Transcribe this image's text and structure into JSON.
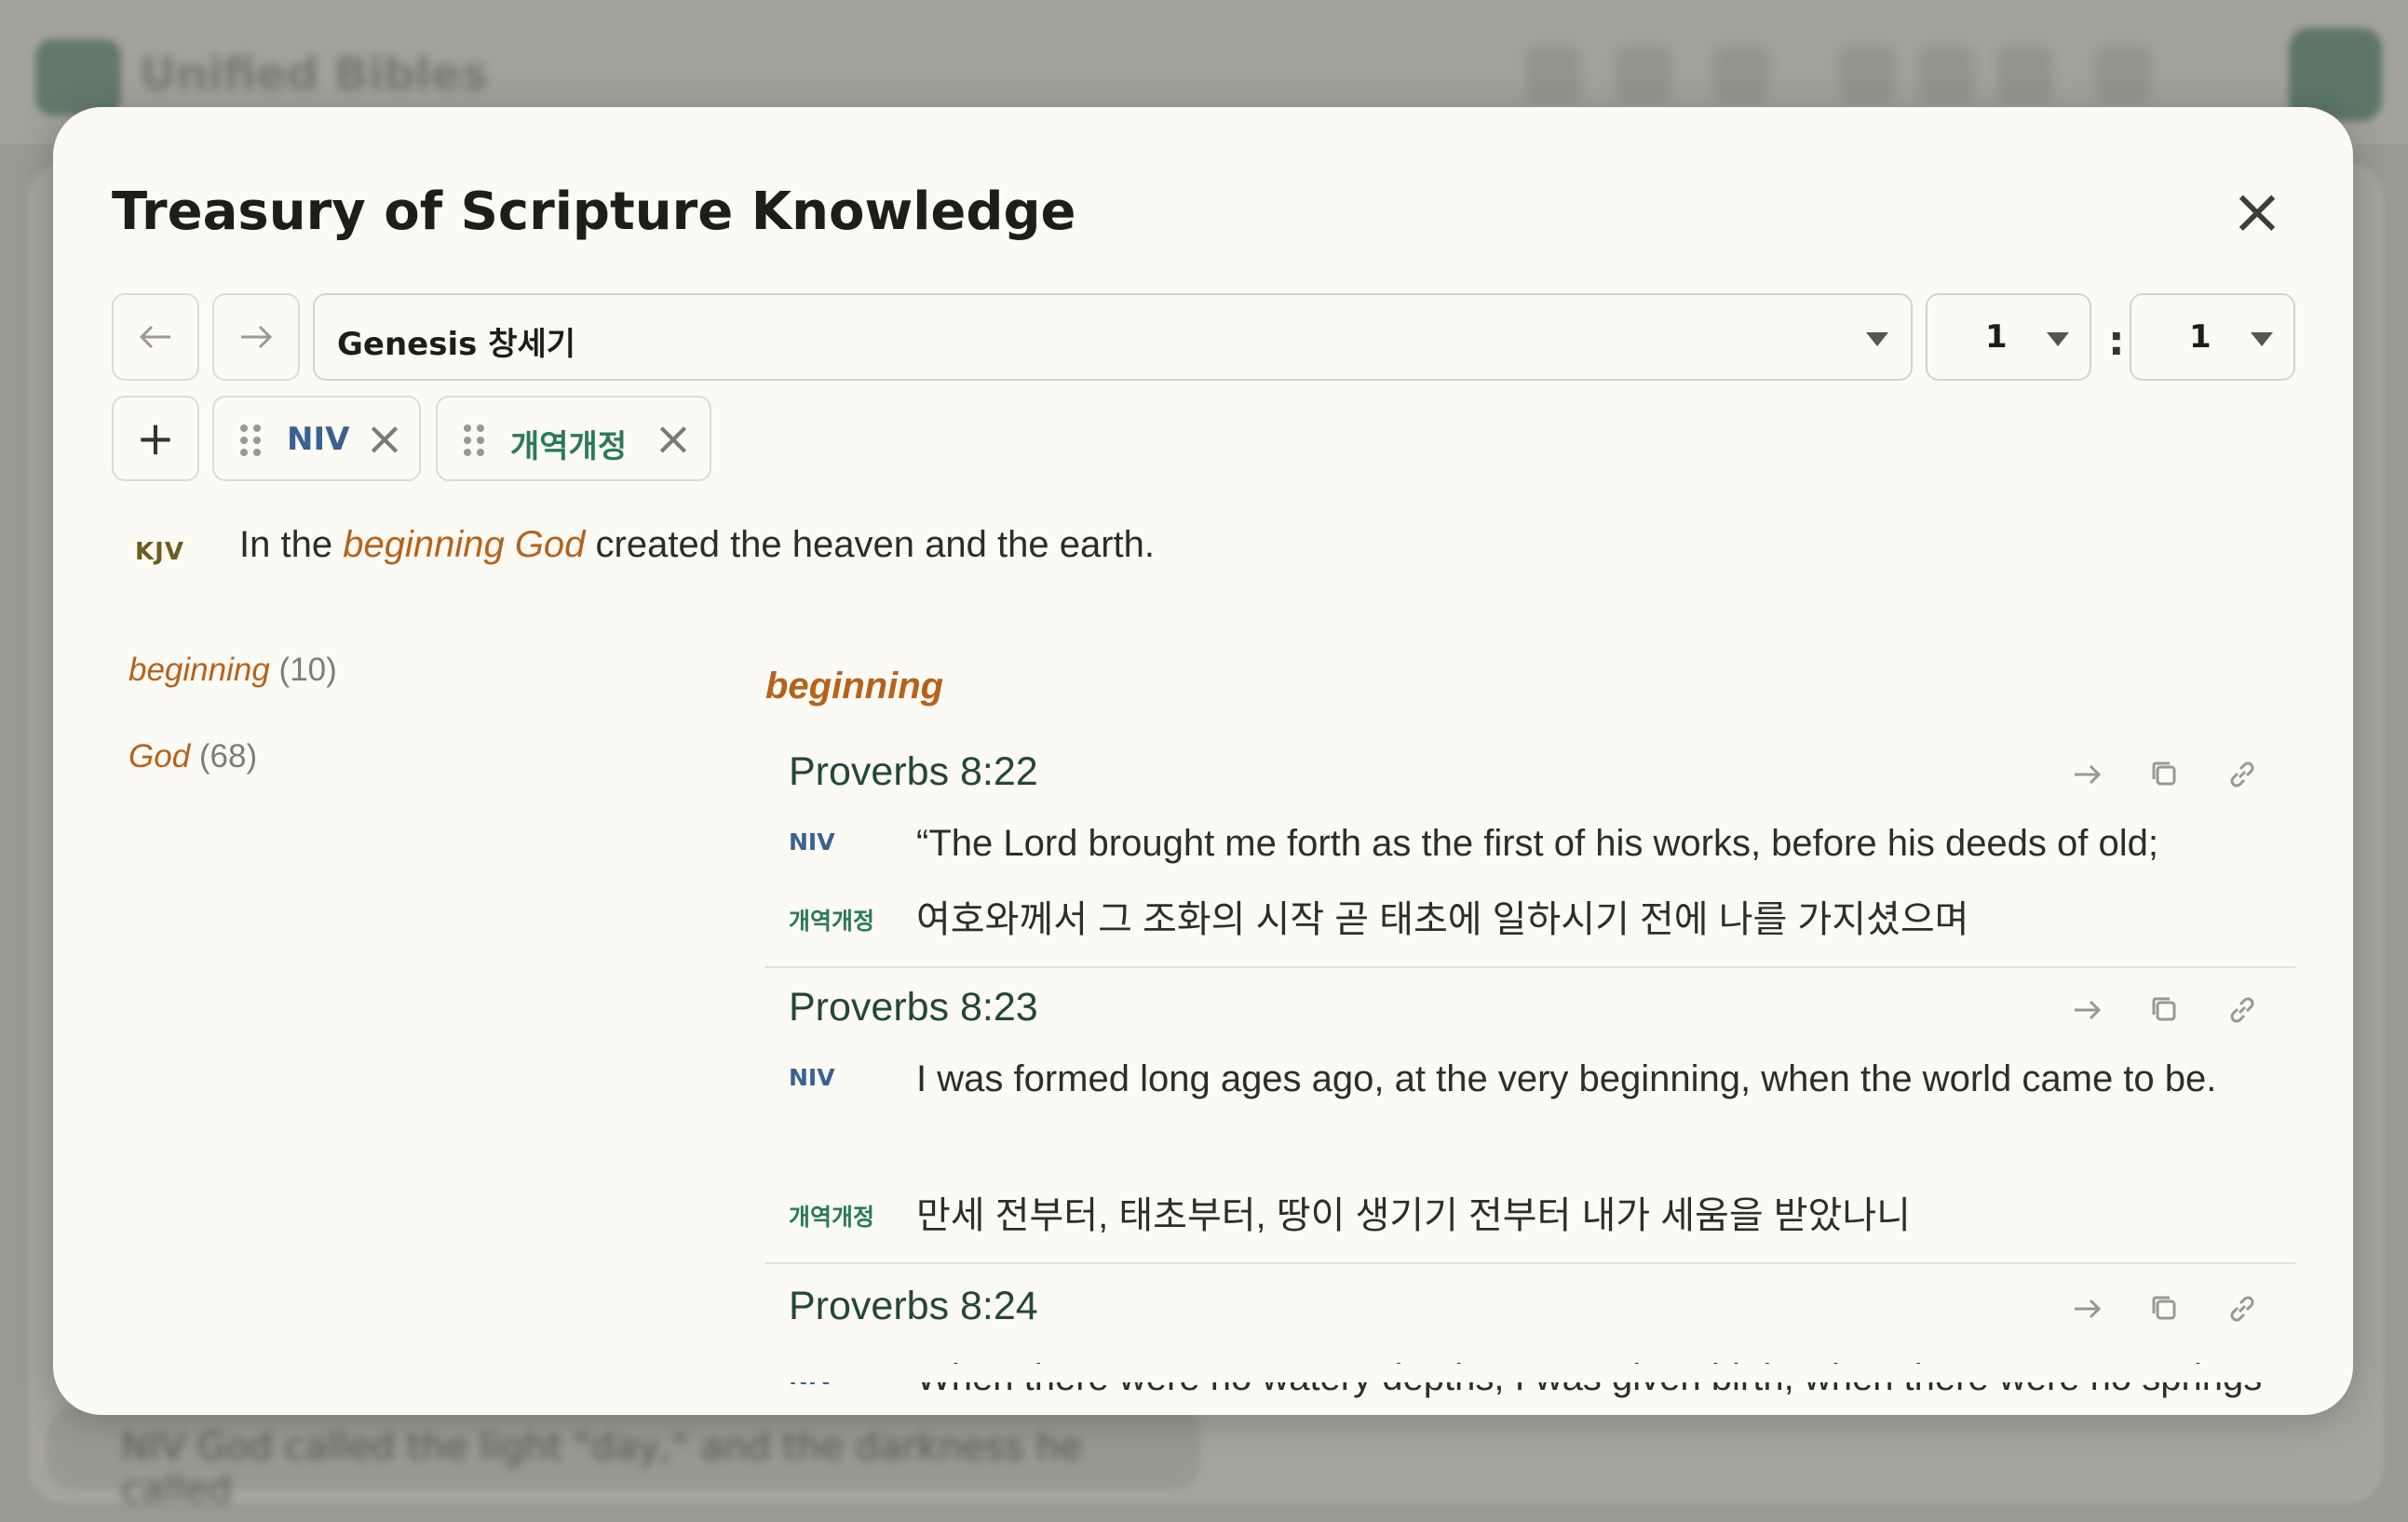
{
  "background": {
    "app_title": "Unified Bibles",
    "bottom_verse": "NIV God called the light \"day,\" and the darkness he called"
  },
  "modal": {
    "title": "Treasury of Scripture Knowledge",
    "close_icon": "close-icon"
  },
  "nav": {
    "back_icon": "arrow-left-icon",
    "forward_icon": "arrow-right-icon",
    "book": "Genesis 창세기",
    "chapter": "1",
    "separator": ":",
    "verse": "1"
  },
  "versions": {
    "add_label": "+",
    "chips": [
      {
        "label": "NIV",
        "color": "#3a6191"
      },
      {
        "label": "개역개정",
        "color": "#2b7a58"
      }
    ]
  },
  "main_verse": {
    "version": "KJV",
    "text_before": "In the ",
    "highlight": "beginning God",
    "text_after": " created the heaven and the earth."
  },
  "keywords": [
    {
      "word": "beginning",
      "count": "(10)"
    },
    {
      "word": "God",
      "count": "(68)"
    }
  ],
  "section": {
    "heading": "beginning",
    "entries": [
      {
        "ref": "Proverbs 8:22",
        "niv_tag": "NIV",
        "niv": "“The Lord brought me forth as the first of his works, before his deeds of old;",
        "krv_tag": "개역개정",
        "krv": "여호와께서 그 조화의 시작 곧 태초에 일하시기 전에 나를 가지셨으며"
      },
      {
        "ref": "Proverbs 8:23",
        "niv_tag": "NIV",
        "niv": "I was formed long ages ago, at the very beginning, when the world came to be.",
        "krv_tag": "개역개정",
        "krv": "만세 전부터, 태초부터, 땅이 생기기 전부터 내가 세움을 받았나니"
      },
      {
        "ref": "Proverbs 8:24",
        "niv_tag": "NIV",
        "niv": "When there were no watery depths, I was given birth, when there were no springs overflowing with water;"
      }
    ]
  },
  "colors": {
    "accent_green": "#23473a",
    "highlight_orange": "#b5631c",
    "modal_bg": "#fbfaf4"
  }
}
